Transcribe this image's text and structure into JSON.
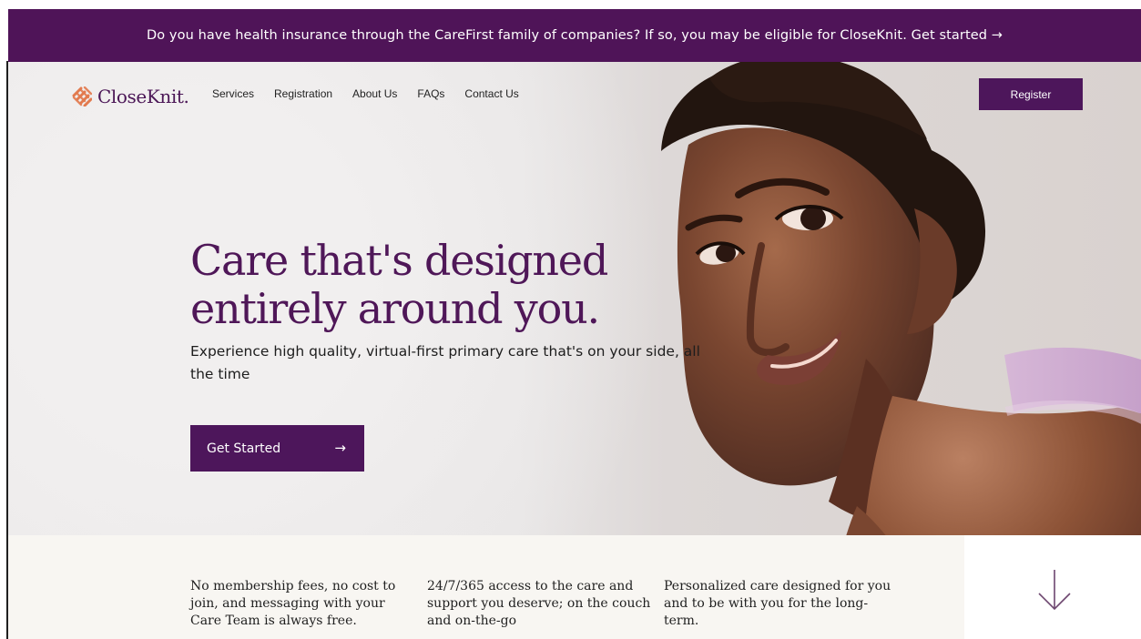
{
  "banner": {
    "text": "Do you have health insurance through the CareFirst family of companies? If so, you may be eligible for CloseKnit. Get started →"
  },
  "header": {
    "logo_text": "CloseKnit.",
    "logo_icon": "closeknit-weave-icon",
    "nav": [
      {
        "label": "Services"
      },
      {
        "label": "Registration"
      },
      {
        "label": "About Us"
      },
      {
        "label": "FAQs"
      },
      {
        "label": "Contact Us"
      }
    ],
    "register_label": "Register"
  },
  "hero": {
    "title_line_1": "Care that's designed",
    "title_line_2": "entirely around you.",
    "subtitle": "Experience high quality, virtual-first primary care that's on your side, all the time",
    "cta_label": "Get Started",
    "cta_icon": "arrow-right-icon",
    "image_description": "Smiling woman portrait"
  },
  "features": [
    {
      "text": "No membership fees, no cost to join, and messaging with your Care Team is always free."
    },
    {
      "text": "24/7/365 access to the care and support you deserve; on the couch and on-the-go"
    },
    {
      "text": "Personalized care designed for you and to be with you for the long-term."
    }
  ],
  "scroll": {
    "icon": "arrow-down-icon"
  },
  "colors": {
    "brand_purple": "#4f1458",
    "logo_orange": "#e27a4e",
    "panel": "#f8f6f2",
    "hero_bg": "#e8e6e6"
  }
}
